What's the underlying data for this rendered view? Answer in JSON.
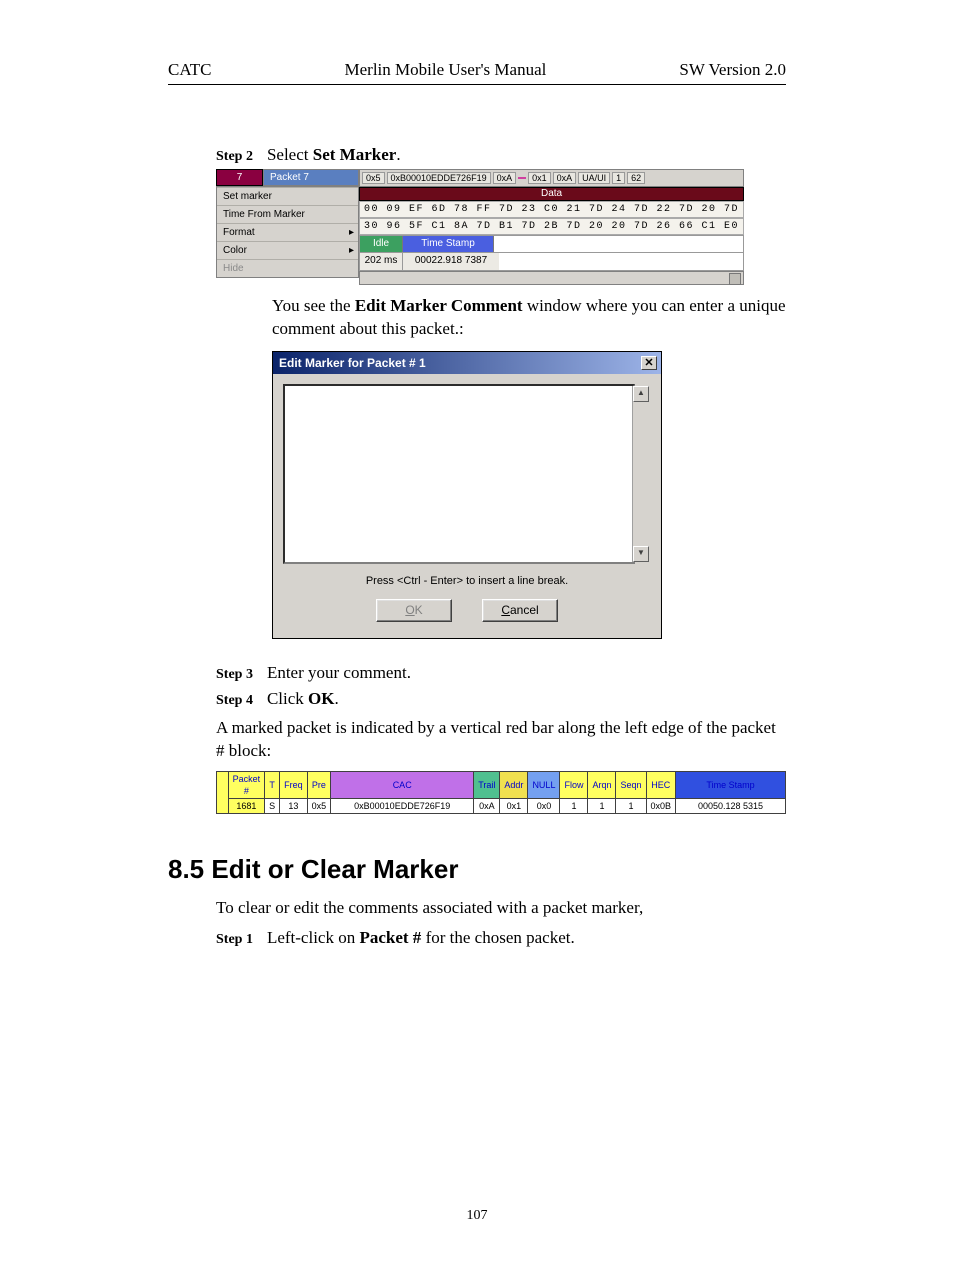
{
  "header": {
    "left": "CATC",
    "center": "Merlin Mobile User's Manual",
    "right": "SW Version 2.0"
  },
  "step2": {
    "label": "Step 2",
    "prefix": "Select ",
    "bold": "Set Marker",
    "suffix": "."
  },
  "ss1": {
    "left_index": "7",
    "menu": {
      "title": "Packet 7",
      "items": [
        "Set marker",
        "Time From Marker",
        "Format",
        "Color",
        "Hide"
      ],
      "arrow_indices": [
        2,
        3
      ]
    },
    "hdr_chips": [
      "0x5",
      "0xB00010EDDE726F19",
      "0xA",
      "",
      "0x1",
      "0xA",
      "UA/UI",
      "1",
      "62"
    ],
    "data_label": "Data",
    "hex_row1": "00 09 EF 6D 78 FF 7D 23 C0 21 7D 24 7D 22 7D 20 7D",
    "hex_row2": "30 96 5F C1 8A 7D B1 7D 2B 7D 20 20 7D 26 66 C1 E0",
    "idle": "Idle",
    "ts_label": "Time Stamp",
    "val_202": "202 ms",
    "ts_value": "00022.918 7387"
  },
  "after_ss1_a": "You see the ",
  "after_ss1_b": "Edit Marker Comment",
  "after_ss1_c": " window where you can enter a unique comment about this packet.:",
  "ss2": {
    "title": "Edit Marker for Packet # 1",
    "hint": "Press <Ctrl - Enter> to insert a line break.",
    "ok": "OK",
    "cancel": "Cancel",
    "up": "▲",
    "down": "▼",
    "close": "✕"
  },
  "step3": {
    "label": "Step 3",
    "text": "Enter your comment."
  },
  "step4": {
    "label": "Step 4",
    "prefix": "Click ",
    "bold": "OK",
    "suffix": "."
  },
  "marked_text": "A marked packet is indicated by a vertical red bar along the left edge of the packet # block:",
  "ss3": {
    "headers": [
      "Packet #",
      "T",
      "Freq",
      "Pre",
      "CAC",
      "Trail",
      "Addr",
      "NULL",
      "Flow",
      "Arqn",
      "Seqn",
      "HEC",
      "Time Stamp"
    ],
    "row": [
      "1681",
      "S",
      "13",
      "0x5",
      "0xB00010EDDE726F19",
      "0xA",
      "0x1",
      "0x0",
      "1",
      "1",
      "1",
      "0x0B",
      "00050.128 5315"
    ]
  },
  "section85": {
    "heading": "8.5  Edit or Clear Marker",
    "intro": "To clear or edit the comments associated with a packet marker,"
  },
  "s85_step1": {
    "label": "Step 1",
    "prefix": "Left-click on ",
    "bold": "Packet #",
    "suffix": " for the chosen packet."
  },
  "page_number": "107"
}
